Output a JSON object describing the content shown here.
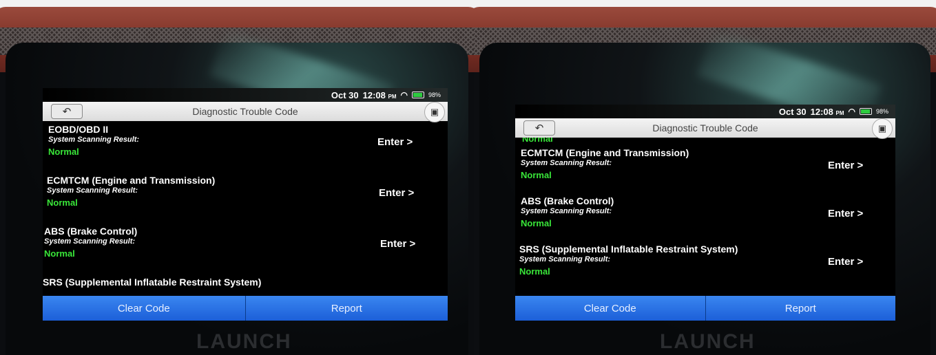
{
  "device": {
    "brand": "LAUNCH"
  },
  "status_bar": {
    "date": "Oct 30",
    "time": "12:08",
    "ampm": "PM",
    "battery": "98%"
  },
  "header": {
    "title": "Diagnostic Trouble Code",
    "back_icon": "back-arrow-icon",
    "camera_icon": "camera-icon"
  },
  "systems": [
    {
      "name": "EOBD/OBD II",
      "subtitle": "System Scanning Result:",
      "status": "Normal",
      "action": "Enter >"
    },
    {
      "name": "ECMTCM (Engine and Transmission)",
      "subtitle": "System Scanning Result:",
      "status": "Normal",
      "action": "Enter >"
    },
    {
      "name": "ABS (Brake Control)",
      "subtitle": "System Scanning Result:",
      "status": "Normal",
      "action": "Enter >"
    },
    {
      "name": "SRS (Supplemental Inflatable Restraint System)",
      "subtitle": "System Scanning Result:",
      "status": "Normal",
      "action": "Enter >"
    }
  ],
  "footer": {
    "clear_label": "Clear Code",
    "report_label": "Report"
  },
  "colors": {
    "status_ok": "#39e639",
    "button_blue": "#2f76e8"
  }
}
